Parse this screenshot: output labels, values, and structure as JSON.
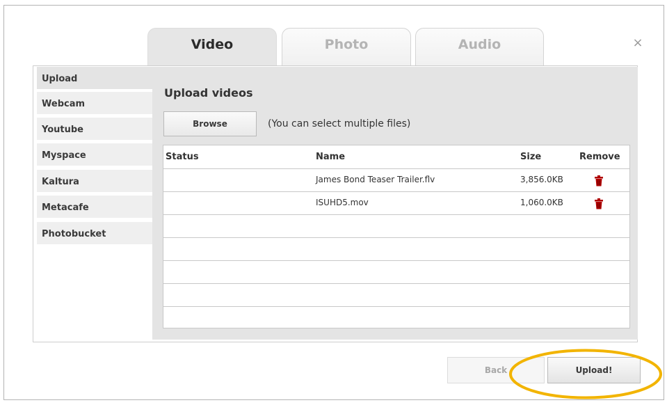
{
  "tabs": [
    {
      "label": "Video",
      "active": true
    },
    {
      "label": "Photo",
      "active": false
    },
    {
      "label": "Audio",
      "active": false
    }
  ],
  "close_label": "×",
  "sidebar": {
    "items": [
      {
        "label": "Upload",
        "active": true
      },
      {
        "label": "Webcam",
        "active": false
      },
      {
        "label": "Youtube",
        "active": false
      },
      {
        "label": "Myspace",
        "active": false
      },
      {
        "label": "Kaltura",
        "active": false
      },
      {
        "label": "Metacafe",
        "active": false
      },
      {
        "label": "Photobucket",
        "active": false
      }
    ]
  },
  "main": {
    "title": "Upload videos",
    "browse_label": "Browse",
    "browse_hint": "(You can select multiple files)",
    "table": {
      "headers": {
        "status": "Status",
        "name": "Name",
        "size": "Size",
        "remove": "Remove"
      },
      "rows": [
        {
          "status": "",
          "name": "James Bond Teaser Trailer.flv",
          "size": "3,856.0KB",
          "remove_icon": "trash-icon"
        },
        {
          "status": "",
          "name": "ISUHD5.mov",
          "size": "1,060.0KB",
          "remove_icon": "trash-icon"
        }
      ]
    }
  },
  "footer": {
    "back_label": "Back",
    "upload_label": "Upload!"
  },
  "colors": {
    "highlight": "#f2b400",
    "trash": "#b00000"
  }
}
